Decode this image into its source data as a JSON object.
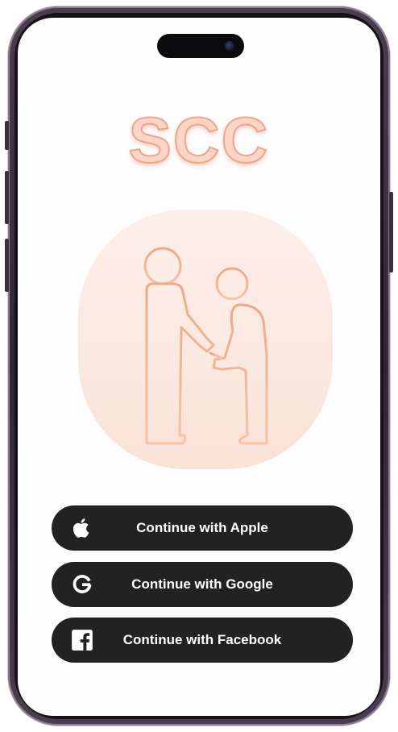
{
  "app": {
    "logo_text": "SCC"
  },
  "auth": {
    "apple_label": "Continue with Apple",
    "google_label": "Continue with Google",
    "facebook_label": "Continue with Facebook"
  },
  "icons": {
    "apple": "apple-icon",
    "google": "google-icon",
    "facebook": "facebook-icon",
    "illustration": "caregiver-elderly-illustration"
  },
  "colors": {
    "logo_fill": "#fbd6c6",
    "logo_stroke": "#f0a48a",
    "button_bg": "#222222",
    "button_text": "#ffffff",
    "illustration_bg": "#fbe8e0",
    "illustration_stroke": "#eea987"
  }
}
